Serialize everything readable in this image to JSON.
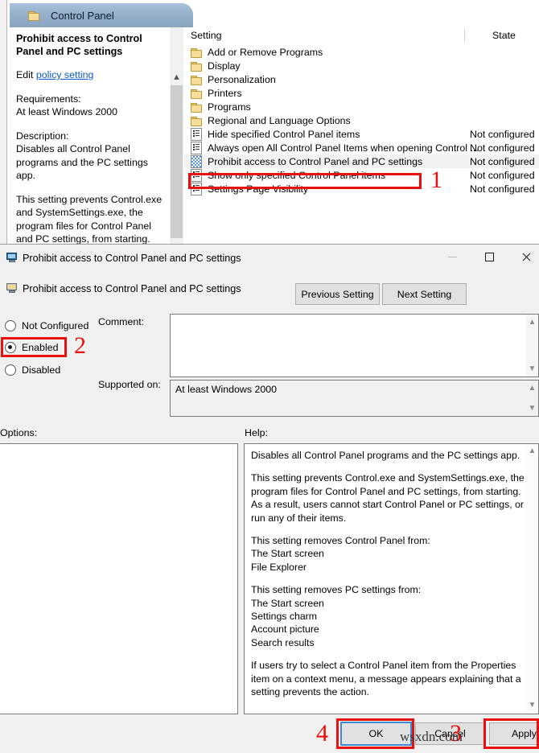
{
  "gpedit": {
    "tab_label": "Control Panel",
    "detail": {
      "title": "Prohibit access to Control Panel and PC settings",
      "edit_prefix": "Edit",
      "edit_link": "policy setting",
      "requirements_label": "Requirements:",
      "requirements_value": "At least Windows 2000",
      "description_label": "Description:",
      "description_p1": "Disables all Control Panel programs and the PC settings app.",
      "description_p2": "This setting prevents Control.exe and SystemSettings.exe, the program files for Control Panel and PC settings, from starting. As a result, users cannot start Control"
    },
    "list": {
      "header_setting": "Setting",
      "header_state": "State",
      "rows": [
        {
          "label": "Add or Remove Programs",
          "state": "",
          "icon": "folder-icon",
          "selected": false
        },
        {
          "label": "Display",
          "state": "",
          "icon": "folder-icon",
          "selected": false
        },
        {
          "label": "Personalization",
          "state": "",
          "icon": "folder-icon",
          "selected": false
        },
        {
          "label": "Printers",
          "state": "",
          "icon": "folder-icon",
          "selected": false
        },
        {
          "label": "Programs",
          "state": "",
          "icon": "folder-icon",
          "selected": false
        },
        {
          "label": "Regional and Language Options",
          "state": "",
          "icon": "folder-icon",
          "selected": false
        },
        {
          "label": "Hide specified Control Panel items",
          "state": "Not configured",
          "icon": "policy-icon",
          "selected": false
        },
        {
          "label": "Always open All Control Panel Items when opening Control ...",
          "state": "Not configured",
          "icon": "policy-icon",
          "selected": false
        },
        {
          "label": "Prohibit access to Control Panel and PC settings",
          "state": "Not configured",
          "icon": "policy-icon",
          "selected": true
        },
        {
          "label": "Show only specified Control Panel items",
          "state": "Not configured",
          "icon": "policy-icon",
          "selected": false
        },
        {
          "label": "Settings Page Visibility",
          "state": "Not configured",
          "icon": "policy-icon",
          "selected": false
        }
      ]
    }
  },
  "dialog": {
    "title": "Prohibit access to Control Panel and PC settings",
    "header_title": "Prohibit access to Control Panel and PC settings",
    "previous_setting": "Previous Setting",
    "next_setting": "Next Setting",
    "states": {
      "not_configured": "Not Configured",
      "enabled": "Enabled",
      "disabled": "Disabled",
      "selected": "Enabled"
    },
    "comment_label": "Comment:",
    "comment_value": "",
    "supported_label": "Supported on:",
    "supported_value": "At least Windows 2000",
    "options_label": "Options:",
    "help_label": "Help:",
    "help_text": {
      "p1": "Disables all Control Panel programs and the PC settings app.",
      "p2": "This setting prevents Control.exe and SystemSettings.exe, the program files for Control Panel and PC settings, from starting. As a result, users cannot start Control Panel or PC settings, or run any of their items.",
      "p3_head": "This setting removes Control Panel from:",
      "p3_l1": "The Start screen",
      "p3_l2": "File Explorer",
      "p4_head": "This setting removes PC settings from:",
      "p4_l1": "The Start screen",
      "p4_l2": "Settings charm",
      "p4_l3": "Account picture",
      "p4_l4": "Search results",
      "p5": "If users try to select a Control Panel item from the Properties item on a context menu, a message appears explaining that a setting prevents the action."
    },
    "buttons": {
      "ok": "OK",
      "cancel": "Cancel",
      "apply": "Apply"
    }
  },
  "annotations": {
    "step1": "1",
    "step2": "2",
    "step3": "3",
    "step4": "4",
    "accent_color": "#e8110f"
  },
  "watermark": "wsxdn.com"
}
